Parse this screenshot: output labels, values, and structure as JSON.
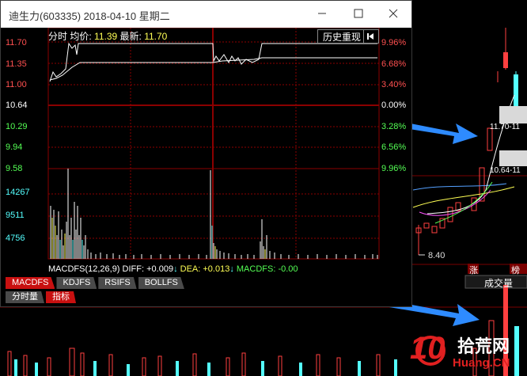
{
  "window": {
    "title": "迪生力(603335) 2018-04-10 星期二",
    "min_icon": "minimize-icon",
    "max_icon": "maximize-icon",
    "close_icon": "close-icon"
  },
  "info": {
    "label": "分时",
    "avg_label": "均价:",
    "avg_value": "11.39",
    "last_label": "最新:",
    "last_value": "11.70"
  },
  "history_button": {
    "label": "历史重现",
    "icon": "go-first-icon"
  },
  "price_axis_left": [
    "11.70",
    "11.35",
    "11.00",
    "10.64",
    "10.29",
    "9.94",
    "9.58"
  ],
  "price_axis_right": [
    "9.96%",
    "6.68%",
    "3.40%",
    "0.00%",
    "3.28%",
    "6.56%",
    "9.96%"
  ],
  "volume_axis": [
    "14267",
    "9511",
    "4756"
  ],
  "macd": {
    "title": "MACDFS(12,26,9)",
    "diff_label": "DIFF:",
    "diff_value": "+0.009",
    "dea_label": "DEA:",
    "dea_value": "+0.013",
    "macdfs_label": "MACDFS:",
    "macdfs_value": "-0.00"
  },
  "indicator_tabs": [
    "MACDFS",
    "KDJFS",
    "RSIFS",
    "BOLLFS"
  ],
  "view_tabs": [
    "分时量",
    "指标"
  ],
  "background": {
    "label_high": "11.70-11",
    "label_low": "10.64-11",
    "low_price": "8.40",
    "zhang": "涨",
    "pan": "榜",
    "volume_label": "成交量",
    "watermark_num": "10",
    "watermark_site": "拾荒网",
    "watermark_domain": "Huang.CN"
  },
  "colors": {
    "up": "#ff3232",
    "down": "#54ffff",
    "price_line": "#ffffff",
    "avg_line": "#ffff54",
    "grid": "#8b0000",
    "accent": "#2e8bff"
  }
}
